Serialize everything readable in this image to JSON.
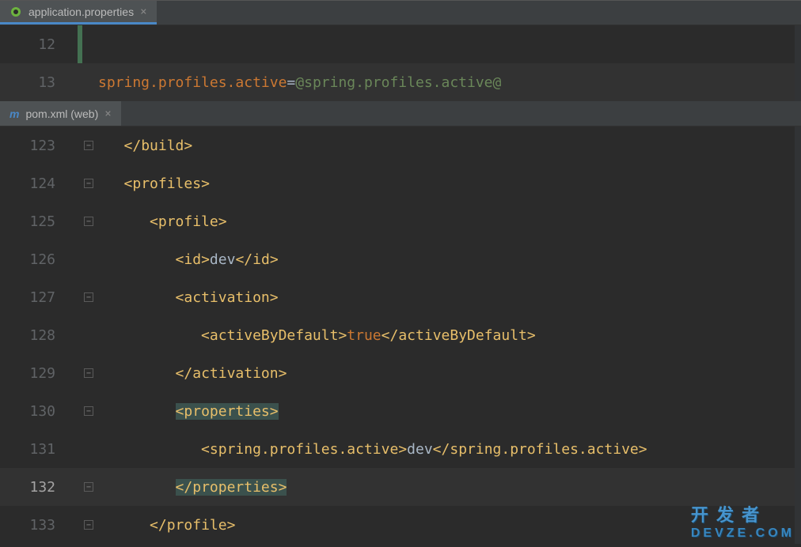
{
  "pane1": {
    "tab": {
      "name": "application.properties"
    },
    "lines": [
      {
        "num": "12",
        "content": "",
        "greenbar": true
      },
      {
        "num": "13",
        "current": true,
        "kind": "props",
        "key": "spring.profiles.active",
        "eq": "=",
        "val": "@spring.profiles.active@"
      }
    ]
  },
  "pane2": {
    "tab": {
      "name": "pom.xml (web)"
    },
    "lines": [
      {
        "num": "123",
        "fold": "up",
        "indent": "   ",
        "raw": "</build>"
      },
      {
        "num": "124",
        "fold": "down",
        "indent": "   ",
        "open": "<",
        "name": "profiles",
        "close": ">"
      },
      {
        "num": "125",
        "fold": "down",
        "indent": "      ",
        "open": "<",
        "name": "profile",
        "close": ">"
      },
      {
        "num": "126",
        "indent": "         ",
        "open": "<",
        "name": "id",
        "close": ">",
        "text": "dev",
        "open2": "</",
        "name2": "id",
        "close2": ">"
      },
      {
        "num": "127",
        "fold": "down",
        "indent": "         ",
        "open": "<",
        "name": "activation",
        "close": ">"
      },
      {
        "num": "128",
        "indent": "            ",
        "open": "<",
        "name": "activeByDefault",
        "close": ">",
        "kw": "true",
        "open2": "</",
        "name2": "activeByDefault",
        "close2": ">"
      },
      {
        "num": "129",
        "fold": "up",
        "indent": "         ",
        "open": "</",
        "name": "activation",
        "close": ">"
      },
      {
        "num": "130",
        "fold": "down",
        "indent": "         ",
        "hl": true,
        "open": "<",
        "name": "properties",
        "close": ">"
      },
      {
        "num": "131",
        "indent": "            ",
        "open": "<",
        "name": "spring.profiles.active",
        "close": ">",
        "text": "dev",
        "open2": "</",
        "name2": "spring.profiles.active",
        "close2": ">"
      },
      {
        "num": "132",
        "fold": "up",
        "caret": true,
        "indent": "         ",
        "hl": true,
        "open": "</",
        "name": "properties",
        "close": ">"
      },
      {
        "num": "133",
        "fold": "up",
        "indent": "      ",
        "open": "</",
        "name": "profile",
        "close": ">"
      }
    ]
  },
  "watermark": {
    "line1": "开 发 者",
    "line2": "DEVZE.COM"
  }
}
